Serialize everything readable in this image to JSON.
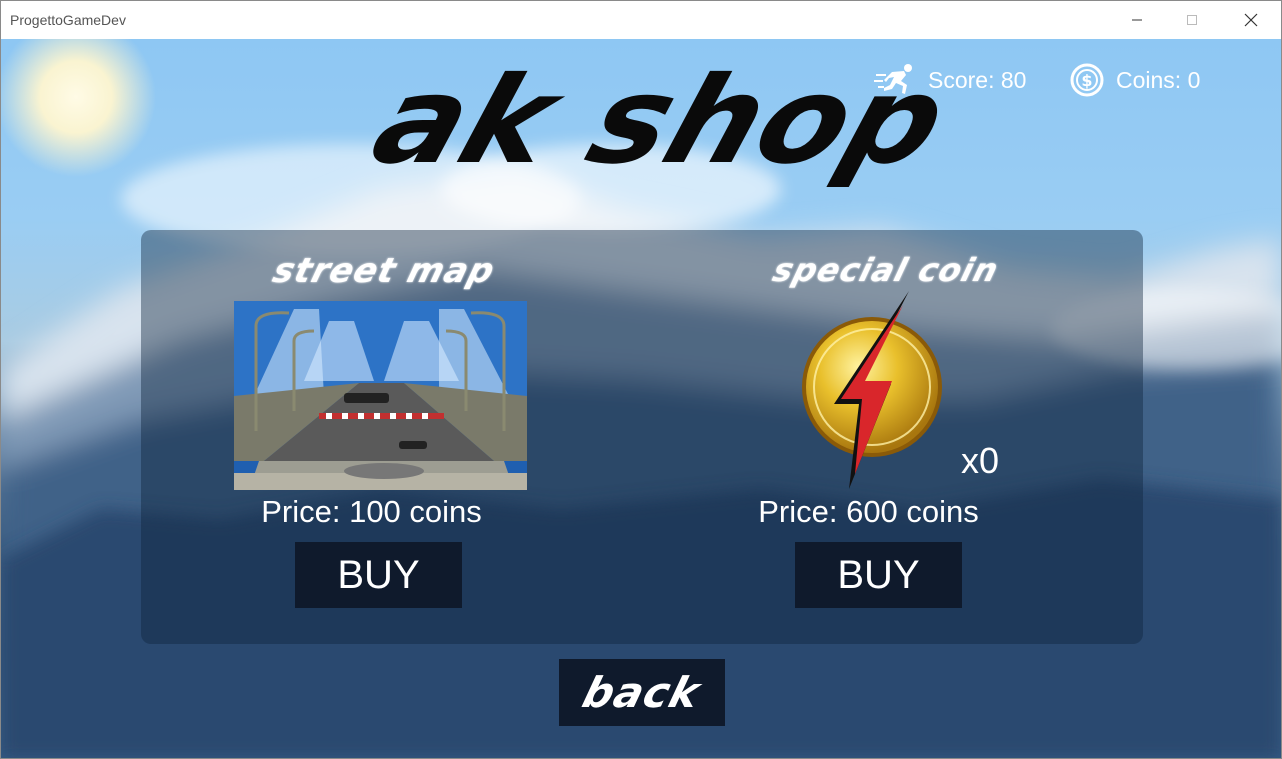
{
  "window": {
    "title": "ProgettoGameDev",
    "controls": [
      "minimize-icon",
      "maximize-icon",
      "close-icon"
    ]
  },
  "hud": {
    "score_label": "Score: 80",
    "coins_label": "Coins: 0",
    "score_icon": "running-man-icon",
    "coins_icon": "dollar-coin-icon"
  },
  "shop": {
    "title": "ak shop",
    "items": [
      {
        "name": "street map",
        "image": "street-map-preview",
        "price_label": "Price: 100 coins",
        "buy_label": "BUY"
      },
      {
        "name": "special coin",
        "image": "lightning-coin-icon",
        "quantity_label": "x0",
        "price_label": "Price: 600 coins",
        "buy_label": "BUY"
      }
    ],
    "back_label": "back"
  },
  "colors": {
    "button_bg": "#0f1a2c",
    "coin_gold": "#e2b422",
    "bolt_red": "#d9262b",
    "sky": "#8ec7f3"
  }
}
